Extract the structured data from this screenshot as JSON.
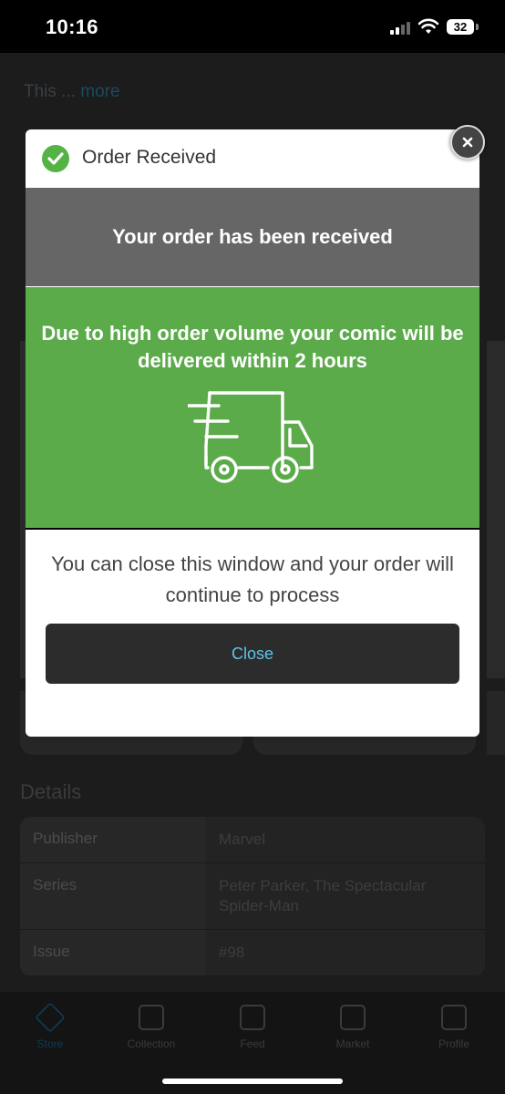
{
  "status_bar": {
    "time": "10:16",
    "battery": "32"
  },
  "background": {
    "description_prefix": "This ...",
    "description_more": "more",
    "details_title": "Details",
    "details": [
      {
        "key": "Publisher",
        "value": "Marvel"
      },
      {
        "key": "Series",
        "value": "Peter Parker, The Spectacular Spider-Man"
      },
      {
        "key": "Issue",
        "value": "#98"
      }
    ]
  },
  "nav": {
    "items": [
      {
        "label": "Store",
        "icon": "tag-icon"
      },
      {
        "label": "Collection",
        "icon": "archive-icon"
      },
      {
        "label": "Feed",
        "icon": "feed-icon"
      },
      {
        "label": "Market",
        "icon": "storefront-icon"
      },
      {
        "label": "Profile",
        "icon": "profile-icon"
      }
    ]
  },
  "modal": {
    "title": "Order Received",
    "received_message": "Your order has been received",
    "delivery_message": "Due to high order volume your comic will be delivered within 2 hours",
    "close_message": "You can close this window and your order will continue to process",
    "close_button": "Close",
    "colors": {
      "success": "#5cab4b",
      "banner": "#666666",
      "button": "#2c2c2c",
      "button_text": "#5fc3e8"
    }
  }
}
